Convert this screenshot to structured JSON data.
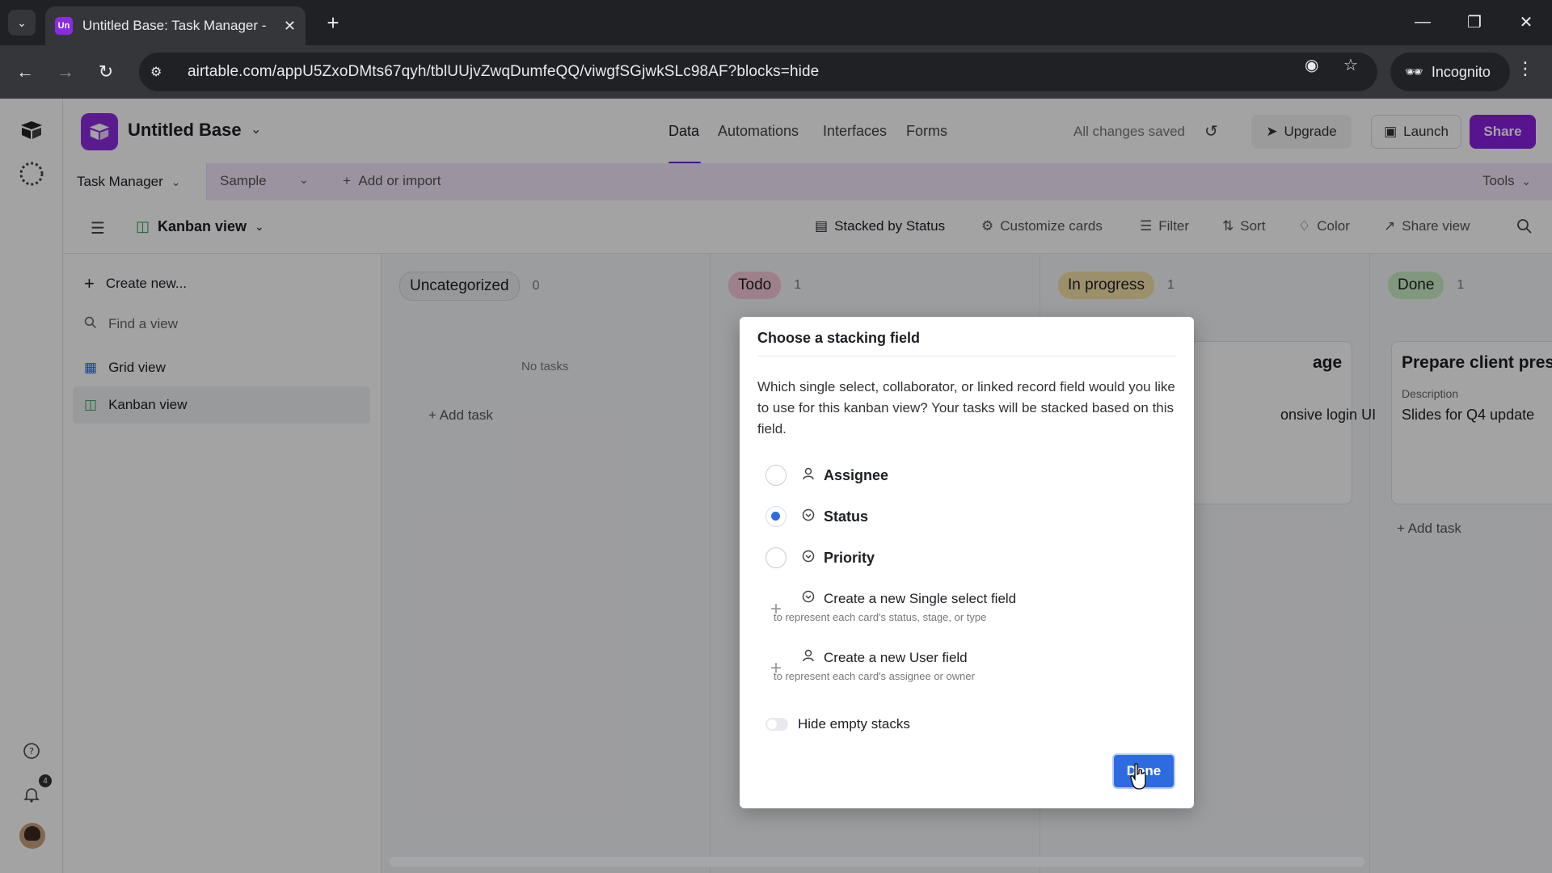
{
  "browser": {
    "tab_title": "Untitled Base: Task Manager - A",
    "favicon_text": "Un",
    "url": "airtable.com/appU5ZxoDMts67qyh/tblUUjvZwqDumfeQQ/viwgfSGjwkSLc98AF?blocks=hide",
    "incognito_label": "Incognito"
  },
  "app": {
    "base_name": "Untitled Base",
    "top_tabs": [
      "Data",
      "Automations",
      "Interfaces",
      "Forms"
    ],
    "active_tab": "Data",
    "save_status": "All changes saved",
    "upgrade_label": "Upgrade",
    "launch_label": "Launch",
    "share_label": "Share",
    "brand_color": "#8a1fe0",
    "notification_count": "4"
  },
  "tablebar": {
    "table_name": "Task Manager",
    "sample_label": "Sample",
    "add_label": "Add or import",
    "tools_label": "Tools"
  },
  "viewbar": {
    "view_name": "Kanban view",
    "stacked_by": "Stacked by Status",
    "customize": "Customize cards",
    "filter": "Filter",
    "sort": "Sort",
    "color": "Color",
    "share_view": "Share view"
  },
  "sidebar": {
    "create_new": "Create new...",
    "find_placeholder": "Find a view",
    "views": [
      {
        "label": "Grid view",
        "icon": "grid-icon"
      },
      {
        "label": "Kanban view",
        "icon": "kanban-icon"
      }
    ]
  },
  "board": {
    "columns": [
      {
        "name": "Uncategorized",
        "count": "0",
        "color": "#eceef1",
        "empty_text": "No tasks",
        "add": "Add task"
      },
      {
        "name": "Todo",
        "count": "1",
        "color": "#f6c9d6"
      },
      {
        "name": "In progress",
        "count": "1",
        "color": "#f5e2a8",
        "card_title_fragment": "age",
        "card_value_fragment": "onsive login UI"
      },
      {
        "name": "Done",
        "count": "1",
        "color": "#cbeec6",
        "card_title": "Prepare client pres",
        "card_label": "Description",
        "card_value": "Slides for Q4 update",
        "add": "Add task"
      }
    ]
  },
  "dialog": {
    "title": "Choose a stacking field",
    "description": "Which single select, collaborator, or linked record field would you like to use for this kanban view? Your tasks will be stacked based on this field.",
    "options": [
      {
        "label": "Assignee",
        "icon": "user-icon",
        "selected": false
      },
      {
        "label": "Status",
        "icon": "single-select-icon",
        "selected": true
      },
      {
        "label": "Priority",
        "icon": "single-select-icon",
        "selected": false
      }
    ],
    "create_options": [
      {
        "label": "Create a new Single select field",
        "sub": "to represent each card's status, stage, or type",
        "icon": "single-select-icon"
      },
      {
        "label": "Create a new User field",
        "sub": "to represent each card's assignee or owner",
        "icon": "user-icon"
      }
    ],
    "hide_empty_label": "Hide empty stacks",
    "hide_empty_on": false,
    "done_label": "Done",
    "accent_color": "#2d6ce0"
  }
}
